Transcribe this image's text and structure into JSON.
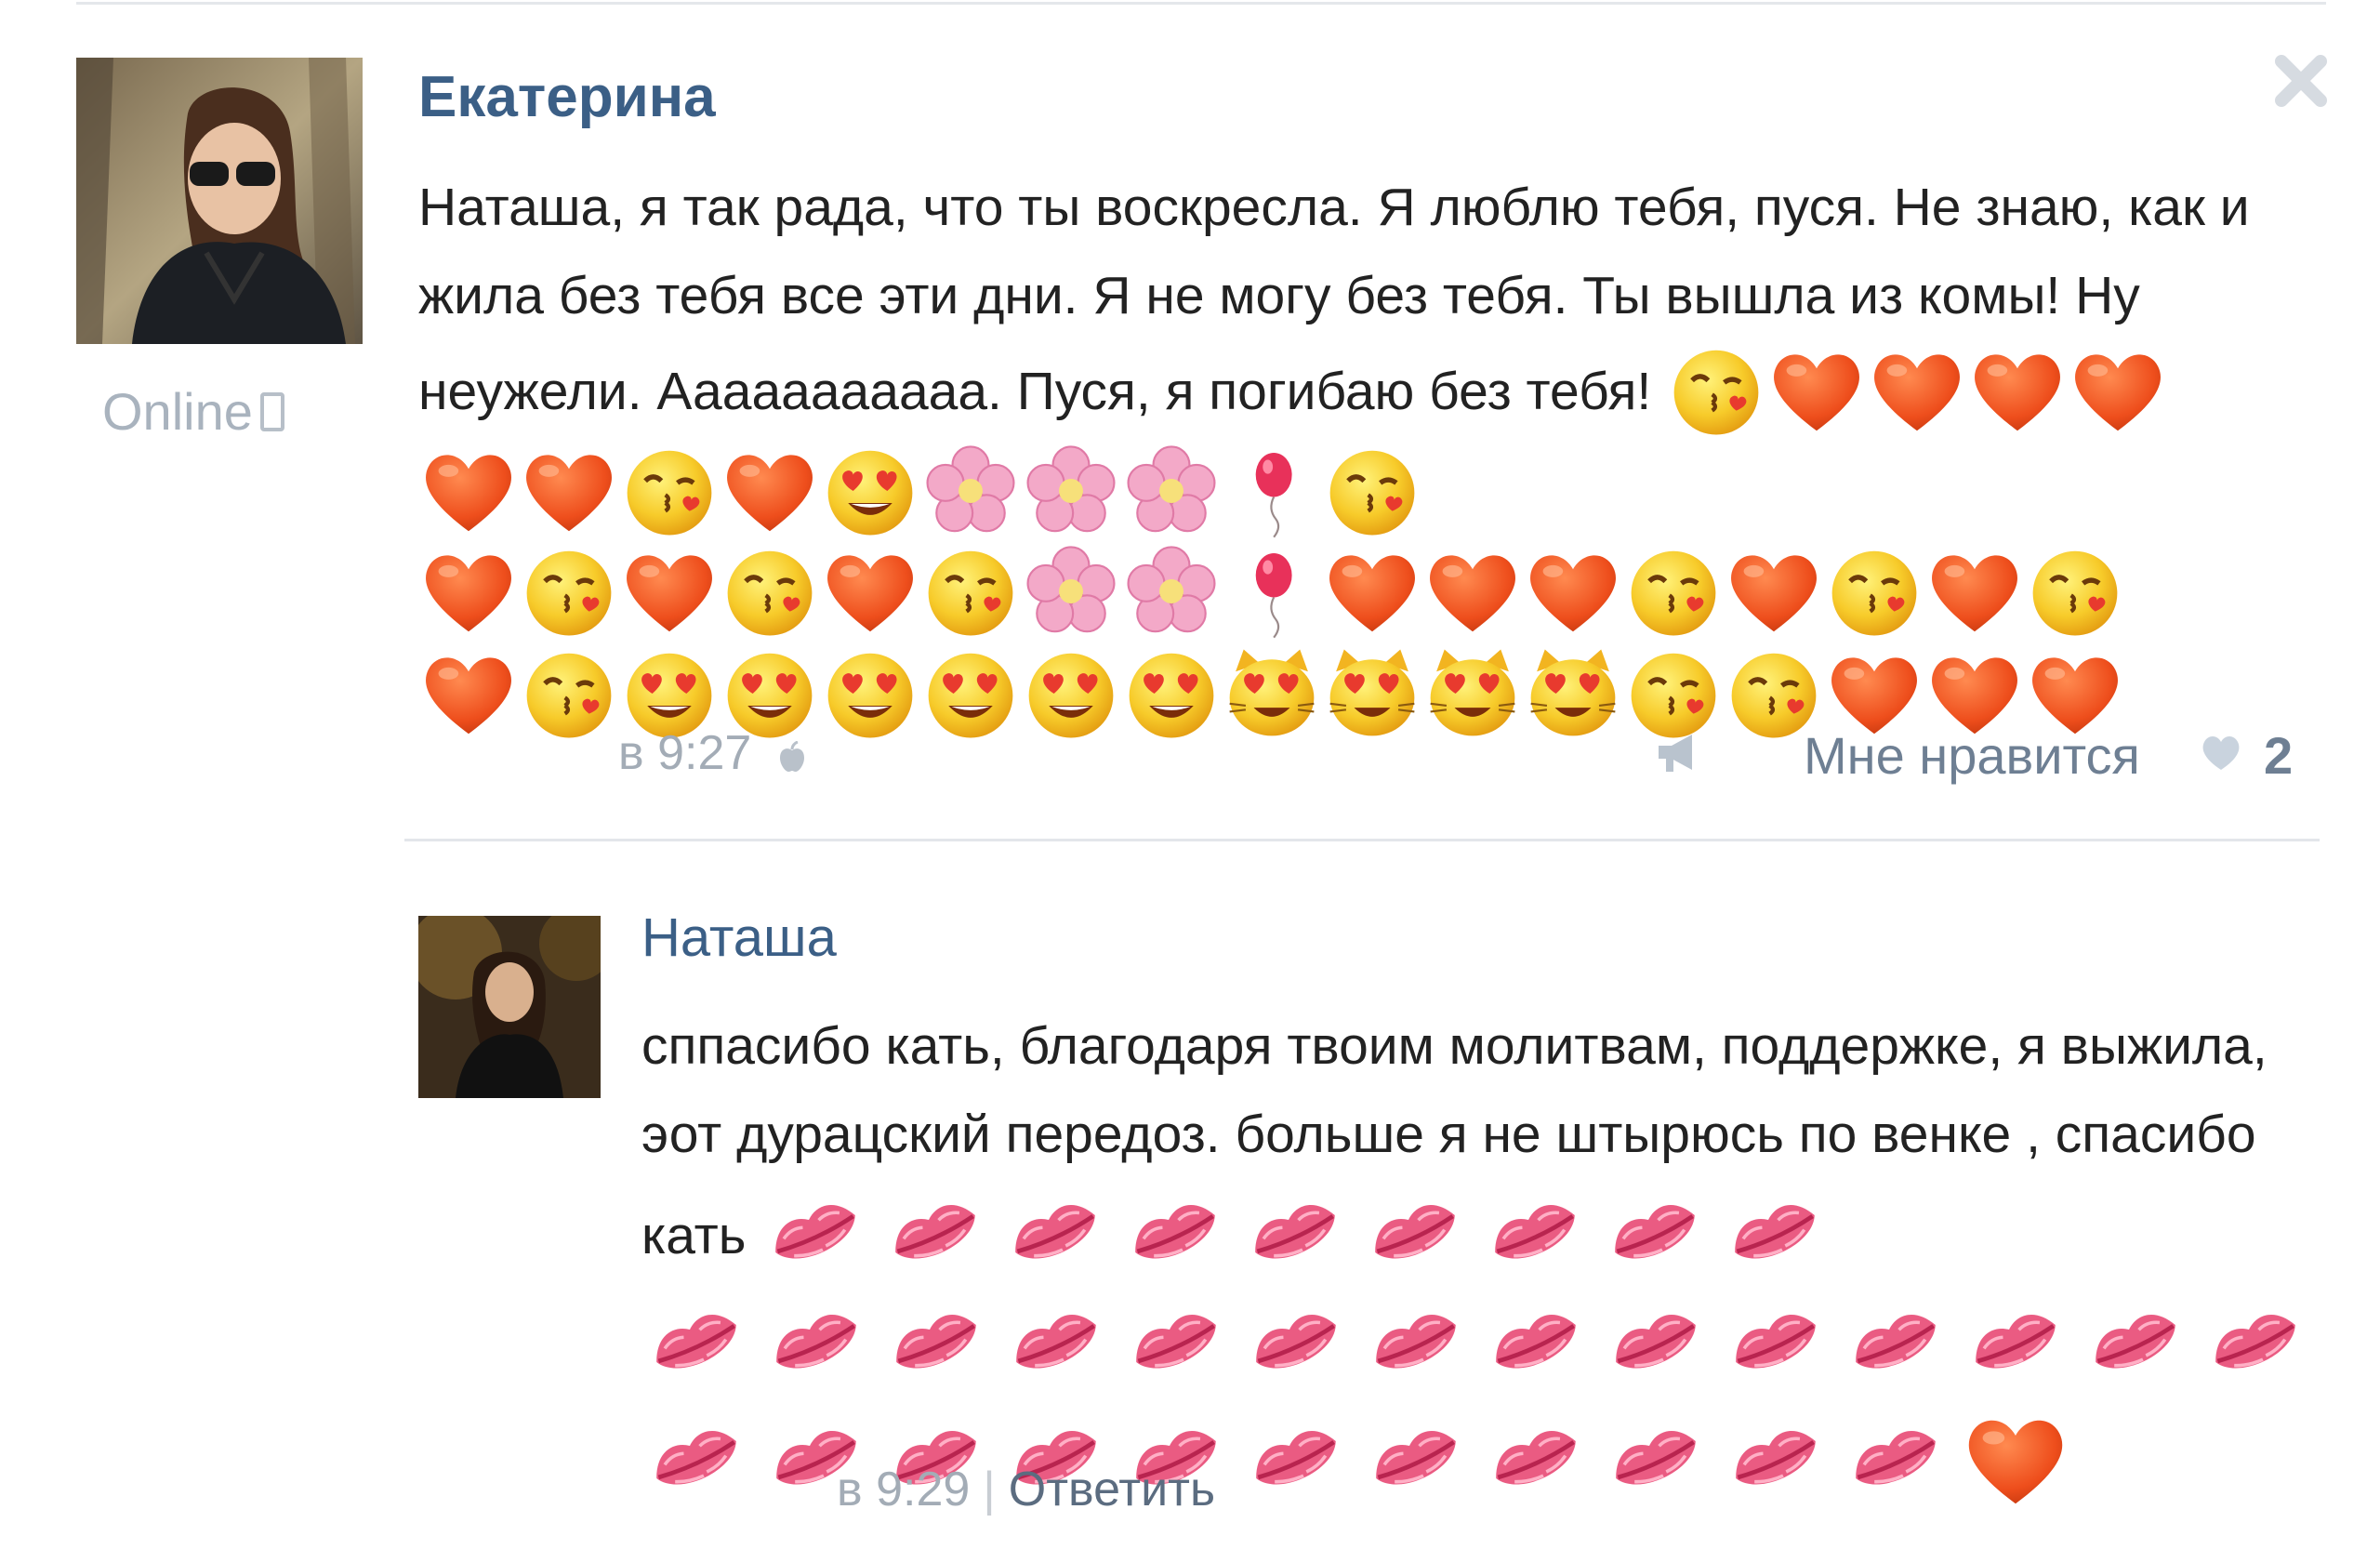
{
  "post": {
    "author": "Екатерина",
    "status": "Online",
    "text": "Наташа, я так рада, что ты воскресла. Я люблю тебя, пуся. Не знаю, как и жила без тебя все эти дни. Я не могу без тебя. Ты вышла из комы! Ну неужели. Ааааааааааа. Пуся, я погибаю без тебя!",
    "emoji_rows": [
      [
        "kiss-face",
        "heart",
        "heart",
        "heart",
        "heart",
        "heart",
        "heart",
        "kiss-face",
        "heart",
        "heart-eyes",
        "flower",
        "flower",
        "flower",
        "balloon",
        "kiss-face"
      ],
      [
        "heart",
        "kiss-face",
        "heart",
        "kiss-face",
        "heart",
        "kiss-face",
        "flower",
        "flower",
        "balloon",
        "heart",
        "heart",
        "heart",
        "kiss-face",
        "heart",
        "kiss-face",
        "heart",
        "kiss-face"
      ],
      [
        "heart",
        "kiss-face",
        "heart-eyes",
        "heart-eyes",
        "heart-eyes",
        "heart-eyes",
        "heart-eyes",
        "heart-eyes",
        "heart-eyes-cat",
        "heart-eyes-cat",
        "heart-eyes-cat",
        "heart-eyes-cat",
        "kiss-face",
        "kiss-face",
        "heart",
        "heart",
        "heart"
      ]
    ],
    "time": "в 9:27",
    "like_label": "Мне нравится",
    "like_count": "2"
  },
  "reply": {
    "author": "Наташа",
    "text": "сппасибо кать, благодаря твоим молитвам, поддержке, я выжила, эот дурацский передоз. больше я не штырюсь по венке , спасибо кать",
    "inline_lips": 9,
    "row2_lips": 14,
    "row3_lips": 11,
    "time": "в 9:29",
    "reply_label": "Ответить"
  },
  "colors": {
    "link": "#3b5f86",
    "meta": "#a3acb6",
    "heart": "#ee5a24",
    "lips": "#e9597f"
  }
}
